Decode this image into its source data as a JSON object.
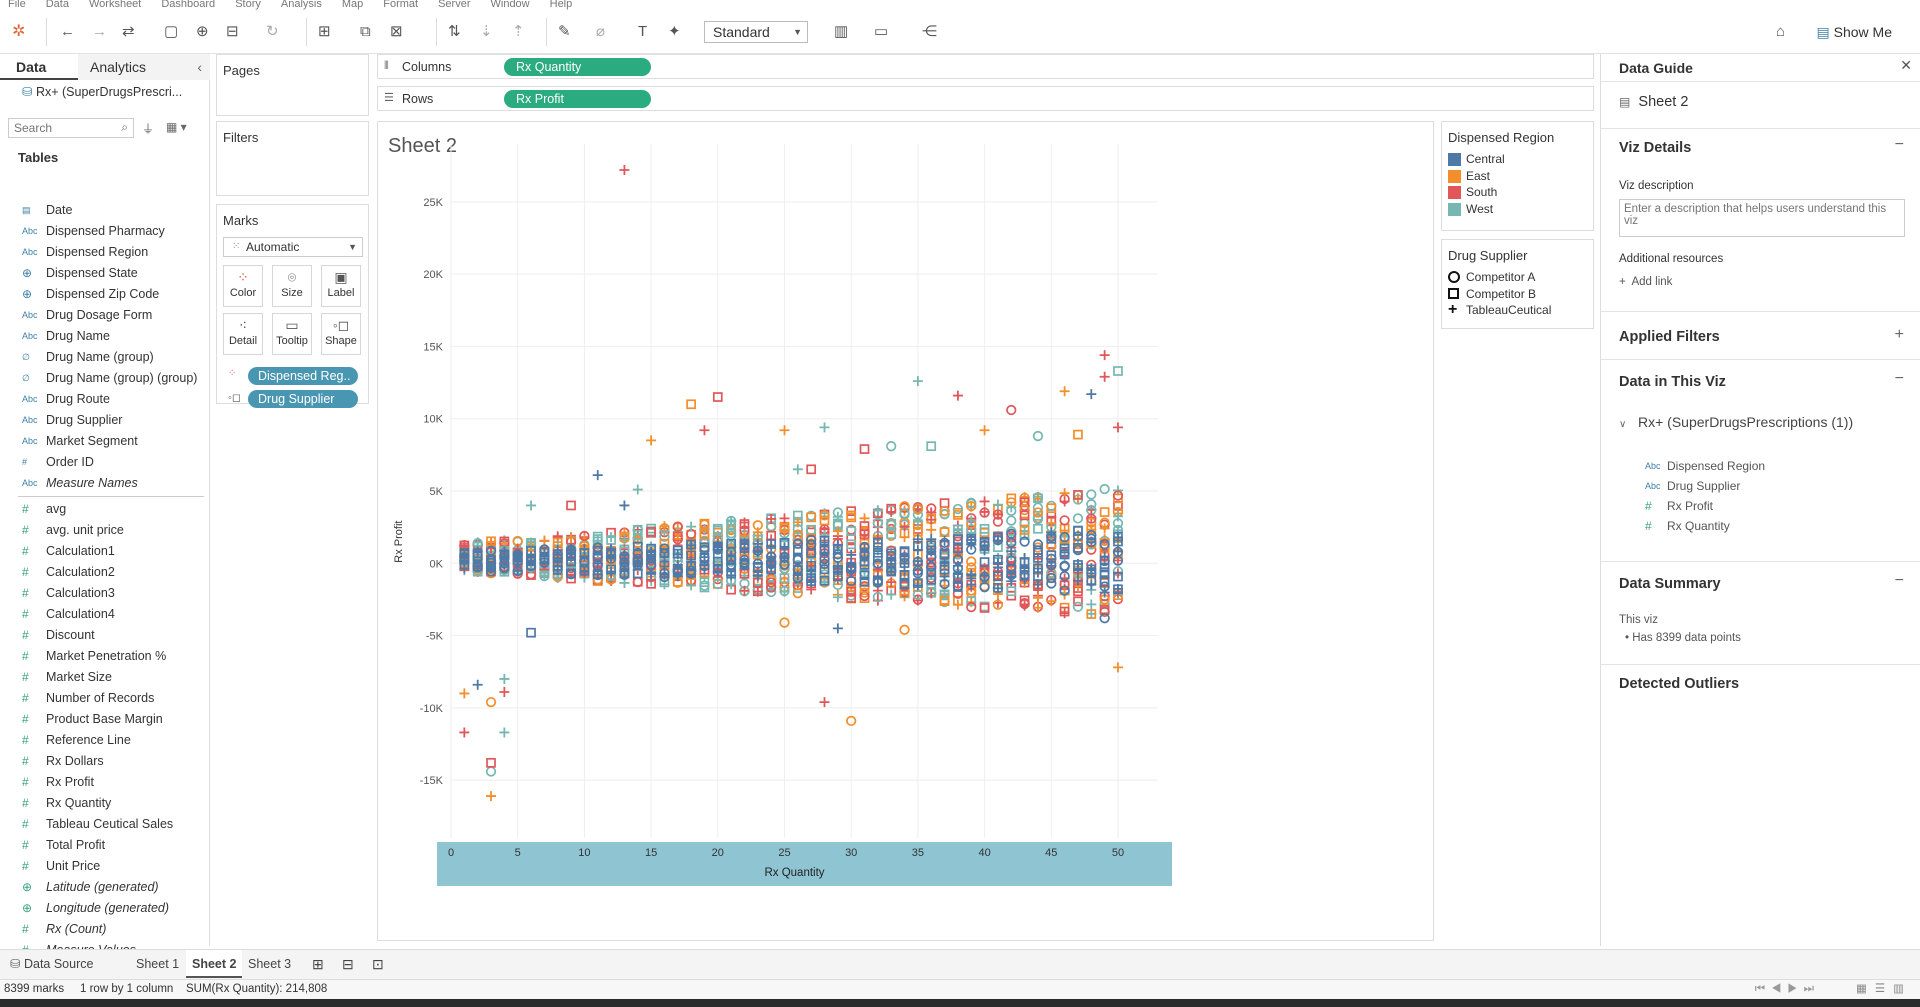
{
  "menu": [
    "File",
    "Data",
    "Worksheet",
    "Dashboard",
    "Story",
    "Analysis",
    "Map",
    "Format",
    "Server",
    "Window",
    "Help"
  ],
  "toolbar": {
    "standard_select": "Standard",
    "show_me": "Show Me"
  },
  "data_pane": {
    "tab_data": "Data",
    "tab_analytics": "Analytics",
    "datasource": "Rx+ (SuperDrugsPrescri...",
    "search_placeholder": "Search",
    "tables_label": "Tables",
    "fields": [
      {
        "label": "Date",
        "type": "date"
      },
      {
        "label": "Dispensed Pharmacy",
        "type": "abc"
      },
      {
        "label": "Dispensed Region",
        "type": "abc"
      },
      {
        "label": "Dispensed State",
        "type": "geo"
      },
      {
        "label": "Dispensed Zip Code",
        "type": "geo"
      },
      {
        "label": "Drug Dosage Form",
        "type": "abc"
      },
      {
        "label": "Drug Name",
        "type": "abc"
      },
      {
        "label": "Drug Name (group)",
        "type": "group"
      },
      {
        "label": "Drug Name (group) (group)",
        "type": "group"
      },
      {
        "label": "Drug Route",
        "type": "abc"
      },
      {
        "label": "Drug Supplier",
        "type": "abc"
      },
      {
        "label": "Market Segment",
        "type": "abc"
      },
      {
        "label": "Order ID",
        "type": "num"
      },
      {
        "label": "Measure Names",
        "type": "abc",
        "italic": true
      }
    ],
    "measures": [
      {
        "label": "avg",
        "type": "num"
      },
      {
        "label": "avg. unit price",
        "type": "num"
      },
      {
        "label": "Calculation1",
        "type": "num"
      },
      {
        "label": "Calculation2",
        "type": "num"
      },
      {
        "label": "Calculation3",
        "type": "num"
      },
      {
        "label": "Calculation4",
        "type": "num"
      },
      {
        "label": "Discount",
        "type": "num"
      },
      {
        "label": "Market Penetration %",
        "type": "num"
      },
      {
        "label": "Market Size",
        "type": "num"
      },
      {
        "label": "Number of Records",
        "type": "num"
      },
      {
        "label": "Product Base Margin",
        "type": "num"
      },
      {
        "label": "Reference Line",
        "type": "num"
      },
      {
        "label": "Rx Dollars",
        "type": "num"
      },
      {
        "label": "Rx Profit",
        "type": "num"
      },
      {
        "label": "Rx Quantity",
        "type": "num"
      },
      {
        "label": "Tableau Ceutical Sales",
        "type": "num"
      },
      {
        "label": "Total Profit",
        "type": "num"
      },
      {
        "label": "Unit Price",
        "type": "num"
      },
      {
        "label": "Latitude (generated)",
        "type": "geo",
        "italic": true
      },
      {
        "label": "Longitude (generated)",
        "type": "geo",
        "italic": true
      },
      {
        "label": "Rx (Count)",
        "type": "num",
        "italic": true
      },
      {
        "label": "Measure Values",
        "type": "num",
        "italic": true
      }
    ]
  },
  "cards": {
    "pages_title": "Pages",
    "filters_title": "Filters",
    "marks_title": "Marks",
    "marks_type": "Automatic",
    "mark_buttons": [
      "Color",
      "Size",
      "Label",
      "Detail",
      "Tooltip",
      "Shape"
    ],
    "mark_pills": [
      "Dispensed Reg..",
      "Drug Supplier"
    ]
  },
  "shelves": {
    "columns_label": "Columns",
    "columns_pill": "Rx Quantity",
    "rows_label": "Rows",
    "rows_pill": "Rx Profit"
  },
  "legends": {
    "region_title": "Dispensed Region",
    "regions": [
      {
        "name": "Central",
        "color": "#4e79a7"
      },
      {
        "name": "East",
        "color": "#f28e2b"
      },
      {
        "name": "South",
        "color": "#e15759"
      },
      {
        "name": "West",
        "color": "#76b7b2"
      }
    ],
    "supplier_title": "Drug Supplier",
    "suppliers": [
      {
        "name": "Competitor A",
        "shape": "circle"
      },
      {
        "name": "Competitor B",
        "shape": "square"
      },
      {
        "name": "TableauCeutical",
        "shape": "plus"
      }
    ]
  },
  "chart_data": {
    "type": "scatter",
    "title": "Sheet 2",
    "xlabel": "Rx Quantity",
    "ylabel": "Rx Profit",
    "xlim": [
      0,
      53
    ],
    "ylim": [
      -19000,
      29000
    ],
    "x_ticks": [
      0,
      5,
      10,
      15,
      20,
      25,
      30,
      35,
      40,
      45,
      50
    ],
    "y_ticks": [
      25000,
      20000,
      15000,
      10000,
      5000,
      0,
      -5000,
      -10000,
      -15000
    ],
    "y_tick_labels": [
      "25K",
      "20K",
      "15K",
      "10K",
      "5K",
      "0K",
      "-5K",
      "-10K",
      "-15K"
    ],
    "grid": true,
    "outliers": [
      {
        "x": 13,
        "y": 27200,
        "region": "South",
        "supplier": "TableauCeutical"
      },
      {
        "x": 49,
        "y": 14400,
        "region": "South",
        "supplier": "TableauCeutical"
      },
      {
        "x": 50,
        "y": 13300,
        "region": "West",
        "supplier": "Competitor B"
      },
      {
        "x": 35,
        "y": 12600,
        "region": "West",
        "supplier": "TableauCeutical"
      },
      {
        "x": 38,
        "y": 11600,
        "region": "South",
        "supplier": "TableauCeutical"
      },
      {
        "x": 20,
        "y": 11500,
        "region": "South",
        "supplier": "Competitor B"
      },
      {
        "x": 18,
        "y": 11000,
        "region": "East",
        "supplier": "Competitor B"
      },
      {
        "x": 46,
        "y": 11900,
        "region": "East",
        "supplier": "TableauCeutical"
      },
      {
        "x": 48,
        "y": 11700,
        "region": "Central",
        "supplier": "TableauCeutical"
      },
      {
        "x": 42,
        "y": 10600,
        "region": "South",
        "supplier": "Competitor A"
      },
      {
        "x": 19,
        "y": 9200,
        "region": "South",
        "supplier": "TableauCeutical"
      },
      {
        "x": 25,
        "y": 9200,
        "region": "East",
        "supplier": "TableauCeutical"
      },
      {
        "x": 28,
        "y": 9400,
        "region": "West",
        "supplier": "TableauCeutical"
      },
      {
        "x": 15,
        "y": 8500,
        "region": "East",
        "supplier": "TableauCeutical"
      },
      {
        "x": 50,
        "y": 9400,
        "region": "South",
        "supplier": "TableauCeutical"
      },
      {
        "x": 3,
        "y": -16100,
        "region": "East",
        "supplier": "TableauCeutical"
      },
      {
        "x": 3,
        "y": -14400,
        "region": "West",
        "supplier": "Competitor A"
      },
      {
        "x": 3,
        "y": -13800,
        "region": "South",
        "supplier": "Competitor B"
      },
      {
        "x": 1,
        "y": -11700,
        "region": "South",
        "supplier": "TableauCeutical"
      },
      {
        "x": 4,
        "y": -11700,
        "region": "West",
        "supplier": "TableauCeutical"
      },
      {
        "x": 30,
        "y": -10900,
        "region": "East",
        "supplier": "Competitor A"
      },
      {
        "x": 28,
        "y": -9600,
        "region": "South",
        "supplier": "TableauCeutical"
      },
      {
        "x": 3,
        "y": -9600,
        "region": "East",
        "supplier": "Competitor A"
      },
      {
        "x": 1,
        "y": -9000,
        "region": "East",
        "supplier": "TableauCeutical"
      },
      {
        "x": 4,
        "y": -8900,
        "region": "South",
        "supplier": "TableauCeutical"
      },
      {
        "x": 2,
        "y": -8400,
        "region": "Central",
        "supplier": "TableauCeutical"
      },
      {
        "x": 4,
        "y": -8000,
        "region": "West",
        "supplier": "TableauCeutical"
      },
      {
        "x": 50,
        "y": -7200,
        "region": "East",
        "supplier": "TableauCeutical"
      },
      {
        "x": 34,
        "y": -4600,
        "region": "East",
        "supplier": "Competitor A"
      },
      {
        "x": 29,
        "y": -4500,
        "region": "Central",
        "supplier": "TableauCeutical"
      },
      {
        "x": 25,
        "y": -4100,
        "region": "East",
        "supplier": "Competitor A"
      },
      {
        "x": 49,
        "y": -3800,
        "region": "Central",
        "supplier": "Competitor A"
      },
      {
        "x": 6,
        "y": -4800,
        "region": "Central",
        "supplier": "Competitor B"
      },
      {
        "x": 6,
        "y": 4000,
        "region": "West",
        "supplier": "TableauCeutical"
      },
      {
        "x": 9,
        "y": 4000,
        "region": "South",
        "supplier": "Competitor B"
      },
      {
        "x": 11,
        "y": 6100,
        "region": "Central",
        "supplier": "TableauCeutical"
      },
      {
        "x": 13,
        "y": 4000,
        "region": "Central",
        "supplier": "TableauCeutical"
      },
      {
        "x": 14,
        "y": 5100,
        "region": "West",
        "supplier": "TableauCeutical"
      },
      {
        "x": 26,
        "y": 6500,
        "region": "West",
        "supplier": "TableauCeutical"
      },
      {
        "x": 27,
        "y": 6500,
        "region": "South",
        "supplier": "Competitor B"
      },
      {
        "x": 31,
        "y": 7900,
        "region": "South",
        "supplier": "Competitor B"
      },
      {
        "x": 33,
        "y": 8100,
        "region": "West",
        "supplier": "Competitor A"
      },
      {
        "x": 36,
        "y": 8100,
        "region": "West",
        "supplier": "Competitor B"
      },
      {
        "x": 40,
        "y": 9200,
        "region": "East",
        "supplier": "TableauCeutical"
      },
      {
        "x": 44,
        "y": 8800,
        "region": "West",
        "supplier": "Competitor A"
      },
      {
        "x": 47,
        "y": 8900,
        "region": "East",
        "supplier": "Competitor B"
      },
      {
        "x": 49,
        "y": 12900,
        "region": "South",
        "supplier": "TableauCeutical"
      }
    ]
  },
  "guide": {
    "title": "Data Guide",
    "sheet": "Sheet 2",
    "viz_details": "Viz Details",
    "viz_description_label": "Viz description",
    "viz_description_placeholder": "Enter a description that helps users understand this viz",
    "additional_resources": "Additional resources",
    "add_link": "Add link",
    "applied_filters": "Applied Filters",
    "data_in_viz": "Data in This Viz",
    "datasource": "Rx+ (SuperDrugsPrescriptions (1))",
    "viz_fields": [
      {
        "label": "Dispensed Region",
        "type": "abc"
      },
      {
        "label": "Drug Supplier",
        "type": "abc"
      },
      {
        "label": "Rx Profit",
        "type": "num"
      },
      {
        "label": "Rx Quantity",
        "type": "num"
      }
    ],
    "data_summary": "Data Summary",
    "this_viz": "This viz",
    "data_points": "Has 8399 data points",
    "detected_outliers": "Detected Outliers"
  },
  "sheet_tabs": {
    "data_source": "Data Source",
    "tabs": [
      "Sheet 1",
      "Sheet 2",
      "Sheet 3"
    ],
    "active": 1
  },
  "status": {
    "marks": "8399 marks",
    "dims": "1 row by 1 column",
    "sum": "SUM(Rx Quantity): 214,808"
  }
}
